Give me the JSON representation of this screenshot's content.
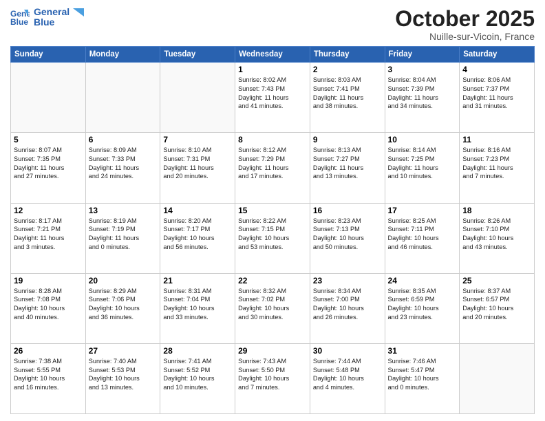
{
  "header": {
    "logo_line1": "General",
    "logo_line2": "Blue",
    "month": "October 2025",
    "location": "Nuille-sur-Vicoin, France"
  },
  "weekdays": [
    "Sunday",
    "Monday",
    "Tuesday",
    "Wednesday",
    "Thursday",
    "Friday",
    "Saturday"
  ],
  "weeks": [
    [
      {
        "day": "",
        "info": ""
      },
      {
        "day": "",
        "info": ""
      },
      {
        "day": "",
        "info": ""
      },
      {
        "day": "1",
        "info": "Sunrise: 8:02 AM\nSunset: 7:43 PM\nDaylight: 11 hours\nand 41 minutes."
      },
      {
        "day": "2",
        "info": "Sunrise: 8:03 AM\nSunset: 7:41 PM\nDaylight: 11 hours\nand 38 minutes."
      },
      {
        "day": "3",
        "info": "Sunrise: 8:04 AM\nSunset: 7:39 PM\nDaylight: 11 hours\nand 34 minutes."
      },
      {
        "day": "4",
        "info": "Sunrise: 8:06 AM\nSunset: 7:37 PM\nDaylight: 11 hours\nand 31 minutes."
      }
    ],
    [
      {
        "day": "5",
        "info": "Sunrise: 8:07 AM\nSunset: 7:35 PM\nDaylight: 11 hours\nand 27 minutes."
      },
      {
        "day": "6",
        "info": "Sunrise: 8:09 AM\nSunset: 7:33 PM\nDaylight: 11 hours\nand 24 minutes."
      },
      {
        "day": "7",
        "info": "Sunrise: 8:10 AM\nSunset: 7:31 PM\nDaylight: 11 hours\nand 20 minutes."
      },
      {
        "day": "8",
        "info": "Sunrise: 8:12 AM\nSunset: 7:29 PM\nDaylight: 11 hours\nand 17 minutes."
      },
      {
        "day": "9",
        "info": "Sunrise: 8:13 AM\nSunset: 7:27 PM\nDaylight: 11 hours\nand 13 minutes."
      },
      {
        "day": "10",
        "info": "Sunrise: 8:14 AM\nSunset: 7:25 PM\nDaylight: 11 hours\nand 10 minutes."
      },
      {
        "day": "11",
        "info": "Sunrise: 8:16 AM\nSunset: 7:23 PM\nDaylight: 11 hours\nand 7 minutes."
      }
    ],
    [
      {
        "day": "12",
        "info": "Sunrise: 8:17 AM\nSunset: 7:21 PM\nDaylight: 11 hours\nand 3 minutes."
      },
      {
        "day": "13",
        "info": "Sunrise: 8:19 AM\nSunset: 7:19 PM\nDaylight: 11 hours\nand 0 minutes."
      },
      {
        "day": "14",
        "info": "Sunrise: 8:20 AM\nSunset: 7:17 PM\nDaylight: 10 hours\nand 56 minutes."
      },
      {
        "day": "15",
        "info": "Sunrise: 8:22 AM\nSunset: 7:15 PM\nDaylight: 10 hours\nand 53 minutes."
      },
      {
        "day": "16",
        "info": "Sunrise: 8:23 AM\nSunset: 7:13 PM\nDaylight: 10 hours\nand 50 minutes."
      },
      {
        "day": "17",
        "info": "Sunrise: 8:25 AM\nSunset: 7:11 PM\nDaylight: 10 hours\nand 46 minutes."
      },
      {
        "day": "18",
        "info": "Sunrise: 8:26 AM\nSunset: 7:10 PM\nDaylight: 10 hours\nand 43 minutes."
      }
    ],
    [
      {
        "day": "19",
        "info": "Sunrise: 8:28 AM\nSunset: 7:08 PM\nDaylight: 10 hours\nand 40 minutes."
      },
      {
        "day": "20",
        "info": "Sunrise: 8:29 AM\nSunset: 7:06 PM\nDaylight: 10 hours\nand 36 minutes."
      },
      {
        "day": "21",
        "info": "Sunrise: 8:31 AM\nSunset: 7:04 PM\nDaylight: 10 hours\nand 33 minutes."
      },
      {
        "day": "22",
        "info": "Sunrise: 8:32 AM\nSunset: 7:02 PM\nDaylight: 10 hours\nand 30 minutes."
      },
      {
        "day": "23",
        "info": "Sunrise: 8:34 AM\nSunset: 7:00 PM\nDaylight: 10 hours\nand 26 minutes."
      },
      {
        "day": "24",
        "info": "Sunrise: 8:35 AM\nSunset: 6:59 PM\nDaylight: 10 hours\nand 23 minutes."
      },
      {
        "day": "25",
        "info": "Sunrise: 8:37 AM\nSunset: 6:57 PM\nDaylight: 10 hours\nand 20 minutes."
      }
    ],
    [
      {
        "day": "26",
        "info": "Sunrise: 7:38 AM\nSunset: 5:55 PM\nDaylight: 10 hours\nand 16 minutes."
      },
      {
        "day": "27",
        "info": "Sunrise: 7:40 AM\nSunset: 5:53 PM\nDaylight: 10 hours\nand 13 minutes."
      },
      {
        "day": "28",
        "info": "Sunrise: 7:41 AM\nSunset: 5:52 PM\nDaylight: 10 hours\nand 10 minutes."
      },
      {
        "day": "29",
        "info": "Sunrise: 7:43 AM\nSunset: 5:50 PM\nDaylight: 10 hours\nand 7 minutes."
      },
      {
        "day": "30",
        "info": "Sunrise: 7:44 AM\nSunset: 5:48 PM\nDaylight: 10 hours\nand 4 minutes."
      },
      {
        "day": "31",
        "info": "Sunrise: 7:46 AM\nSunset: 5:47 PM\nDaylight: 10 hours\nand 0 minutes."
      },
      {
        "day": "",
        "info": ""
      }
    ]
  ]
}
